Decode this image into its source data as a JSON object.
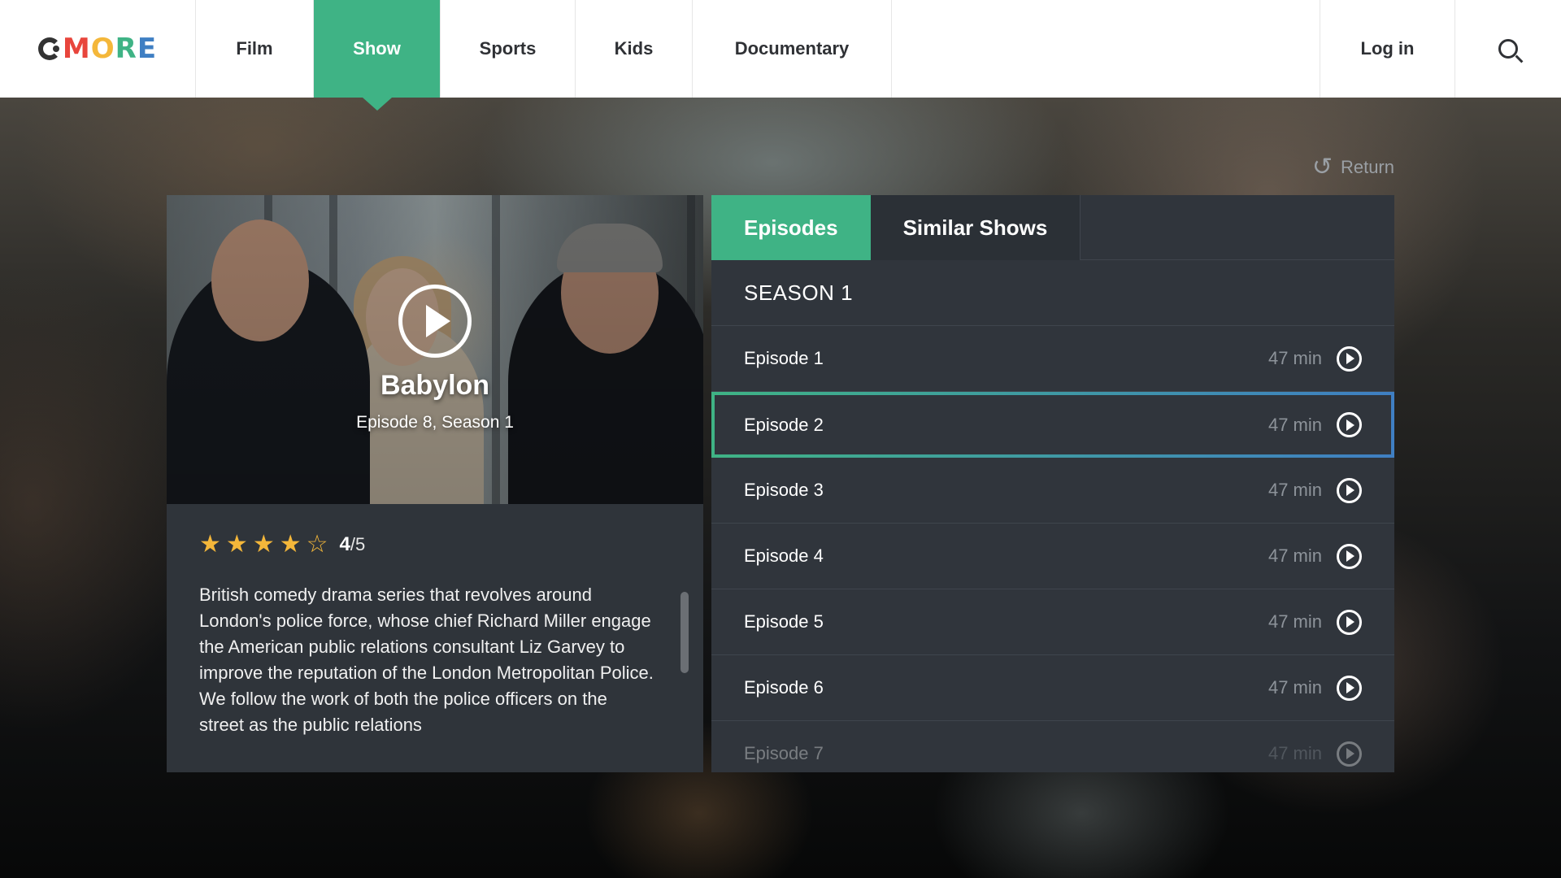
{
  "logo": {
    "letters": [
      {
        "char": "M",
        "color": "#e8453c"
      },
      {
        "char": "O",
        "color": "#f4b73a"
      },
      {
        "char": "R",
        "color": "#3fb385"
      },
      {
        "char": "E",
        "color": "#3f7fc3"
      }
    ]
  },
  "nav": {
    "items": [
      "Film",
      "Show",
      "Sports",
      "Kids",
      "Documentary"
    ],
    "active": "Show",
    "login_label": "Log in"
  },
  "return_label": "Return",
  "show": {
    "title": "Babylon",
    "subtitle": "Episode 8, Season 1",
    "rating_value": "4",
    "rating_max": "/5",
    "rating_stars": 4,
    "rating_total_stars": 5,
    "description": "British comedy drama series that revolves around London's police force, whose chief Richard Miller engage the American public relations consultant Liz Garvey to improve the reputation of the London Metropolitan Police. We follow the work of both the police officers on the street as the public relations"
  },
  "tabs": {
    "episodes": "Episodes",
    "similar": "Similar Shows"
  },
  "season_label": "SEASON 1",
  "episodes": [
    {
      "name": "Episode 1",
      "duration": "47 min"
    },
    {
      "name": "Episode 2",
      "duration": "47 min"
    },
    {
      "name": "Episode 3",
      "duration": "47 min"
    },
    {
      "name": "Episode 4",
      "duration": "47 min"
    },
    {
      "name": "Episode 5",
      "duration": "47 min"
    },
    {
      "name": "Episode 6",
      "duration": "47 min"
    },
    {
      "name": "Episode 7",
      "duration": "47 min"
    }
  ],
  "selected_episode": "Episode 2",
  "colors": {
    "accent": "#3fb385",
    "star": "#f4b73a",
    "focus_gradient_end": "#3f7fc3"
  }
}
